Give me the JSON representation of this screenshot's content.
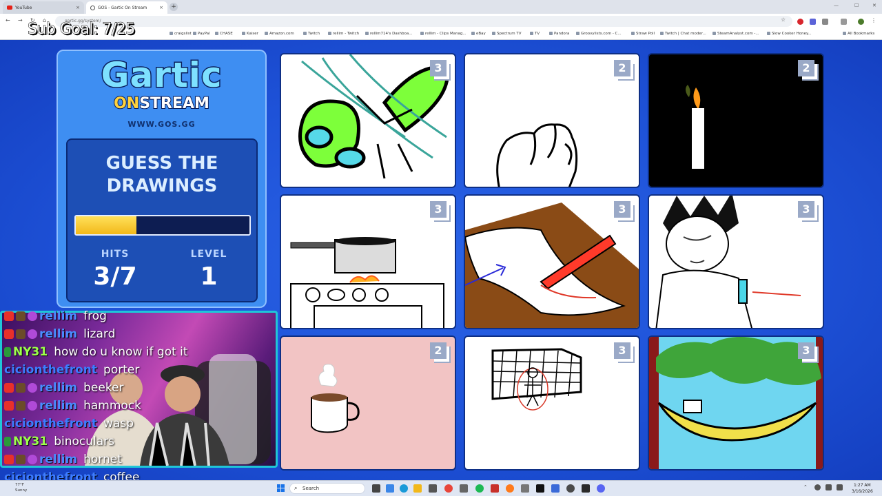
{
  "browser": {
    "tabs": [
      {
        "title": "YouTube",
        "close": "×"
      },
      {
        "title": "GOS - Gartic On Stream",
        "close": "×"
      }
    ],
    "new_tab": "+",
    "address": "gartic.gg/system/",
    "bookmarks": [
      "craigslist",
      "PayPal",
      "CHASE",
      "Kaiser",
      "Amazon.com",
      "Twitch",
      "rellim - Twitch",
      "rellim714's Dashboa...",
      "rellim - Clips Manag...",
      "eBay",
      "Spectrum TV",
      "TV",
      "Pandora",
      "Groovylists.com - C...",
      "Straw Poll",
      "Twitch | Chat moder...",
      "SteamAnalyst.com -...",
      "Slow Cooker Honey..."
    ],
    "all_bookmarks": "All Bookmarks"
  },
  "overlay": {
    "sub_goal": "Sub Goal: 7/25"
  },
  "game": {
    "logo_top": "Gartic",
    "logo_on": "ON",
    "logo_stream": "STREAM",
    "site": "WWW.GOS.GG",
    "heading": "GUESS THE DRAWINGS",
    "progress": 0.35,
    "hits_label": "HITS",
    "hits_value": "3/7",
    "level_label": "LEVEL",
    "level_value": "1",
    "cards": [
      {
        "badge": "3",
        "subject": "fly"
      },
      {
        "badge": "2",
        "subject": "fist"
      },
      {
        "badge": "2",
        "subject": "candle"
      },
      {
        "badge": "3",
        "subject": "stove"
      },
      {
        "badge": "3",
        "subject": "paper and pen"
      },
      {
        "badge": "3",
        "subject": "boy with marker"
      },
      {
        "badge": "2",
        "subject": "coffee"
      },
      {
        "badge": "3",
        "subject": "goal net"
      },
      {
        "badge": "3",
        "subject": "hammock"
      }
    ]
  },
  "chat": [
    {
      "user": "rellim",
      "color": "#4a8cff",
      "text": "frog",
      "badges": true
    },
    {
      "user": "rellim",
      "color": "#4a8cff",
      "text": "lizard",
      "badges": true
    },
    {
      "user": "NY31",
      "color": "#9cff4a",
      "text": "how do u know if got it",
      "badges": false
    },
    {
      "user": "cicionthefront",
      "color": "#3d7cff",
      "text": "porter",
      "badges": false
    },
    {
      "user": "rellim",
      "color": "#4a8cff",
      "text": "beeker",
      "badges": true
    },
    {
      "user": "rellim",
      "color": "#4a8cff",
      "text": "hammock",
      "badges": true
    },
    {
      "user": "cicionthefront",
      "color": "#3d7cff",
      "text": "wasp",
      "badges": false
    },
    {
      "user": "NY31",
      "color": "#9cff4a",
      "text": "binoculars",
      "badges": false
    },
    {
      "user": "rellim",
      "color": "#4a8cff",
      "text": "hornet",
      "badges": true
    },
    {
      "user": "cicionthefront",
      "color": "#3d7cff",
      "text": "coffee",
      "badges": false
    }
  ],
  "taskbar": {
    "weather_temp": "77°F",
    "weather_cond": "Sunny",
    "search": "Search",
    "time": "1:27 AM",
    "date": "3/16/2026"
  }
}
